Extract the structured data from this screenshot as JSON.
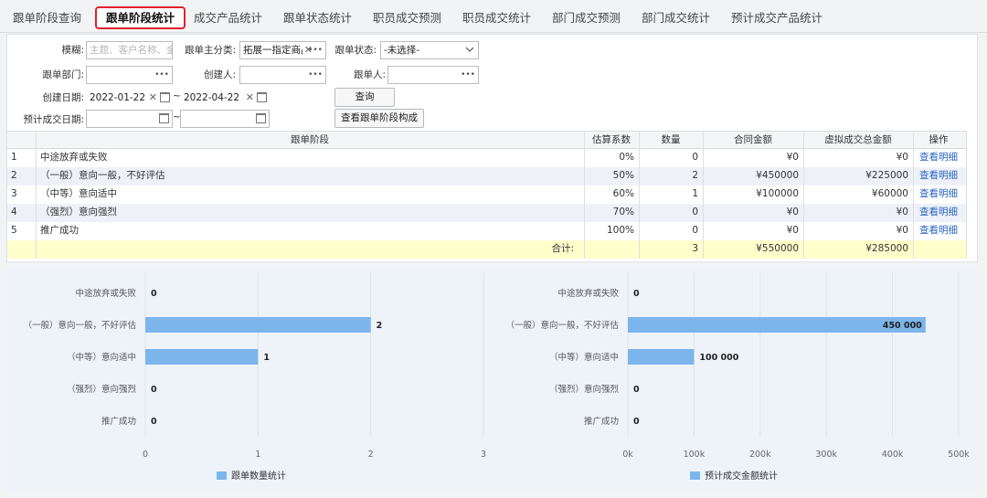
{
  "tabs": [
    "跟单阶段查询",
    "跟单阶段统计",
    "成交产品统计",
    "跟单状态统计",
    "职员成交预测",
    "职员成交统计",
    "部门成交预测",
    "部门成交统计",
    "预计成交产品统计"
  ],
  "active_tab": 1,
  "filters": {
    "fuzzy_label": "模糊:",
    "fuzzy_placeholder": "主题、客户名称、金",
    "main_category_label": "跟单主分类:",
    "main_category_value": "拓展一指定商品",
    "status_label": "跟单状态:",
    "status_value": "-未选择-",
    "dept_label": "跟单部门:",
    "creator_label": "创建人:",
    "follower_label": "跟单人:",
    "created_date_label": "创建日期:",
    "date_from": "2022-01-22",
    "date_to": "2022-04-22",
    "expected_date_label": "预计成交日期:",
    "tilde": "~",
    "query_button": "查询",
    "view_composition_button": "查看跟单阶段构成"
  },
  "table": {
    "headers": [
      "跟单阶段",
      "估算系数",
      "数量",
      "合同金额",
      "虚拟成交总金额",
      "操作"
    ],
    "rows": [
      {
        "idx": "1",
        "stage": "中途放弃或失败",
        "coef": "0%",
        "qty": "0",
        "amount": "¥0",
        "virtual": "¥0",
        "action": "查看明细"
      },
      {
        "idx": "2",
        "stage": "（一般）意向一般，不好评估",
        "coef": "50%",
        "qty": "2",
        "amount": "¥450000",
        "virtual": "¥225000",
        "action": "查看明细"
      },
      {
        "idx": "3",
        "stage": "（中等）意向适中",
        "coef": "60%",
        "qty": "1",
        "amount": "¥100000",
        "virtual": "¥60000",
        "action": "查看明细"
      },
      {
        "idx": "4",
        "stage": "（强烈）意向强烈",
        "coef": "70%",
        "qty": "0",
        "amount": "¥0",
        "virtual": "¥0",
        "action": "查看明细"
      },
      {
        "idx": "5",
        "stage": "推广成功",
        "coef": "100%",
        "qty": "0",
        "amount": "¥0",
        "virtual": "¥0",
        "action": "查看明细"
      }
    ],
    "total_label": "合计:",
    "total_qty": "3",
    "total_amount": "¥550000",
    "total_virtual": "¥285000"
  },
  "chart_data": [
    {
      "type": "bar",
      "orientation": "horizontal",
      "categories": [
        "中途放弃或失败",
        "（一般）意向一般，不好评估",
        "（中等）意向适中",
        "（强烈）意向强烈",
        "推广成功"
      ],
      "values": [
        0,
        2,
        1,
        0,
        0
      ],
      "value_labels": [
        "0",
        "2",
        "1",
        "0",
        "0"
      ],
      "xlim": [
        0,
        3
      ],
      "ticks": [
        "0",
        "1",
        "2",
        "3"
      ],
      "legend": "跟单数量统计",
      "legend_position": "bottom",
      "color": "#7cb5ec"
    },
    {
      "type": "bar",
      "orientation": "horizontal",
      "categories": [
        "中途放弃或失败",
        "（一般）意向一般，不好评估",
        "（中等）意向适中",
        "（强烈）意向强烈",
        "推广成功"
      ],
      "values": [
        0,
        450000,
        100000,
        0,
        0
      ],
      "value_labels": [
        "0",
        "450 000",
        "100 000",
        "0",
        "0"
      ],
      "xlim": [
        0,
        500000
      ],
      "ticks": [
        "0k",
        "100k",
        "200k",
        "300k",
        "400k",
        "500k"
      ],
      "legend": "预计成交金额统计",
      "legend_position": "bottom",
      "color": "#7cb5ec"
    }
  ]
}
